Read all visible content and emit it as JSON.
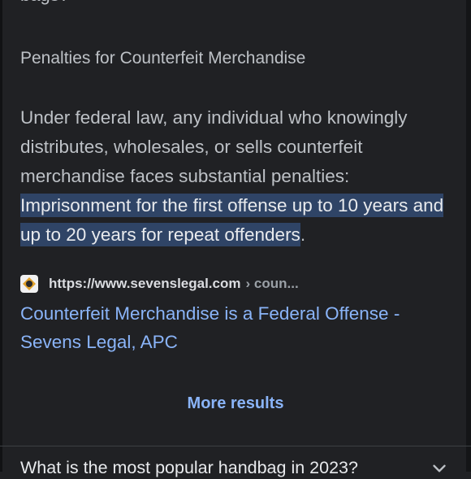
{
  "answer": {
    "cut_top_text": "bags?",
    "heading": "Penalties for Counterfeit Merchandise",
    "paragraph_plain": "Under federal law, any individual who knowingly distributes, wholesales, or sells counterfeit merchandise faces substantial penalties: ",
    "paragraph_highlight": "Imprisonment for the first offense up to 10 years and up to 20 years for repeat offenders",
    "paragraph_end": "."
  },
  "source": {
    "favicon": "sevens-legal-logo",
    "url": "https://www.sevenslegal.com",
    "path": "› coun..."
  },
  "result": {
    "title": "Counterfeit Merchandise is a Federal Offense - Sevens Legal, APC"
  },
  "more_results_label": "More results",
  "next_question": {
    "text": "What is the most popular handbag in 2023?",
    "icon": "chevron-down-icon"
  },
  "colors": {
    "background": "#202124",
    "text": "#bdc1c6",
    "link": "#8ab4f8",
    "highlight": "#2f4466"
  }
}
